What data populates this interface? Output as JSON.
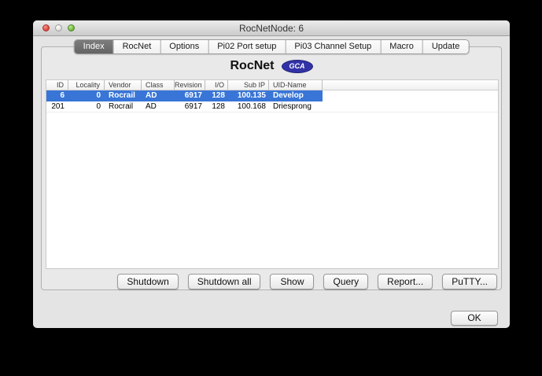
{
  "window": {
    "title": "RocNetNode: 6"
  },
  "tabs": [
    {
      "label": "Index",
      "selected": true
    },
    {
      "label": "RocNet",
      "selected": false
    },
    {
      "label": "Options",
      "selected": false
    },
    {
      "label": "Pi02 Port setup",
      "selected": false
    },
    {
      "label": "Pi03 Channel Setup",
      "selected": false
    },
    {
      "label": "Macro",
      "selected": false
    },
    {
      "label": "Update",
      "selected": false
    }
  ],
  "panel": {
    "heading": "RocNet",
    "badge": "GCA"
  },
  "table": {
    "columns": [
      "ID",
      "Locality",
      "Vendor",
      "Class",
      "Revision",
      "I/O",
      "Sub IP",
      "UID-Name"
    ],
    "rows": [
      {
        "selected": true,
        "cells": [
          "6",
          "0",
          "Rocrail",
          "AD",
          "6917",
          "128",
          "100.135",
          "Develop"
        ]
      },
      {
        "selected": false,
        "cells": [
          "201",
          "0",
          "Rocrail",
          "AD",
          "6917",
          "128",
          "100.168",
          "Driesprong"
        ]
      }
    ]
  },
  "action_buttons": [
    "Shutdown",
    "Shutdown all",
    "Show",
    "Query",
    "Report...",
    "PuTTY..."
  ],
  "dialog": {
    "ok_label": "OK"
  },
  "colors": {
    "selection": "#3875d7",
    "badge": "#3232a8",
    "selected_tab": "#6e6e6e"
  }
}
